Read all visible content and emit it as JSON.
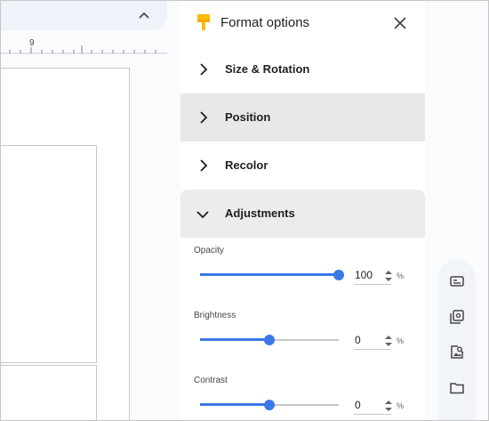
{
  "panel": {
    "title": "Format options",
    "sections": [
      {
        "label": "Size & Rotation",
        "expanded": false
      },
      {
        "label": "Position",
        "expanded": false
      },
      {
        "label": "Recolor",
        "expanded": false
      },
      {
        "label": "Adjustments",
        "expanded": true
      }
    ],
    "adjustments": {
      "opacity": {
        "label": "Opacity",
        "value": "100",
        "unit": "%",
        "fraction": 1.0
      },
      "brightness": {
        "label": "Brightness",
        "value": "0",
        "unit": "%",
        "fraction": 0.5
      },
      "contrast": {
        "label": "Contrast",
        "value": "0",
        "unit": "%",
        "fraction": 0.5
      }
    }
  },
  "ruler": {
    "number": "9"
  },
  "colors": {
    "accent": "#3b78e7",
    "brush": "#fbbc04",
    "panel_shade": "#e8e8e8"
  },
  "icons": {
    "collapse": "chevron-up-icon",
    "close": "close-icon",
    "rail": [
      "caption-icon",
      "image-stack-icon",
      "image-search-icon",
      "folder-icon"
    ]
  }
}
